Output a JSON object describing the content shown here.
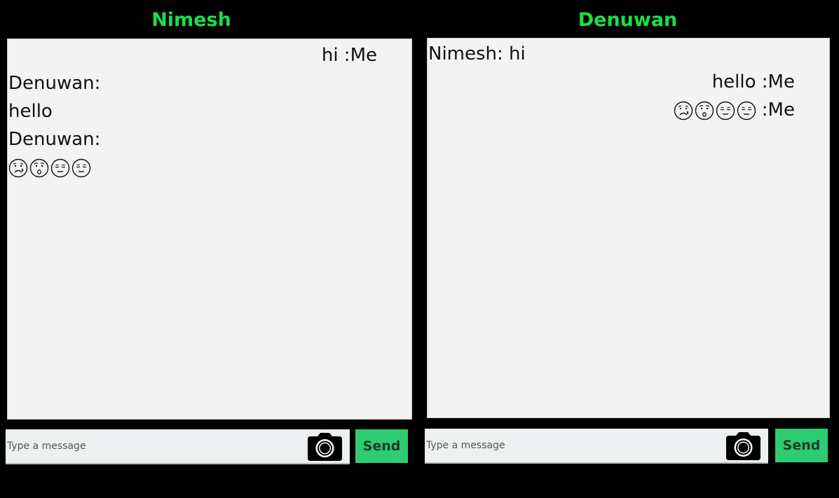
{
  "chats": [
    {
      "title": "Nimesh",
      "messages": [
        {
          "text": "hi :Me",
          "align": "right"
        },
        {
          "text": "Denuwan:",
          "align": "left"
        },
        {
          "text": "hello",
          "align": "left"
        },
        {
          "text": "Denuwan:",
          "align": "left"
        }
      ],
      "emoji_suffix": "",
      "input_placeholder": "Type a message",
      "send_label": "Send"
    },
    {
      "title": "Denuwan",
      "messages": [
        {
          "text": "Nimesh: hi",
          "align": "left"
        },
        {
          "text": "hello :Me",
          "align": "right"
        }
      ],
      "emoji_suffix": ":Me",
      "input_placeholder": "Type a message",
      "send_label": "Send"
    }
  ],
  "emojis": [
    "worried-face-icon",
    "hushed-face-icon",
    "expressionless-face-icon",
    "expressionless-face-icon"
  ],
  "colors": {
    "background": "#000000",
    "title": "#19e046",
    "chat_bg": "#f3f3f3",
    "input_bg": "#edf0f0",
    "send_bg": "#2ecc71",
    "send_text": "#1d3b2a"
  }
}
